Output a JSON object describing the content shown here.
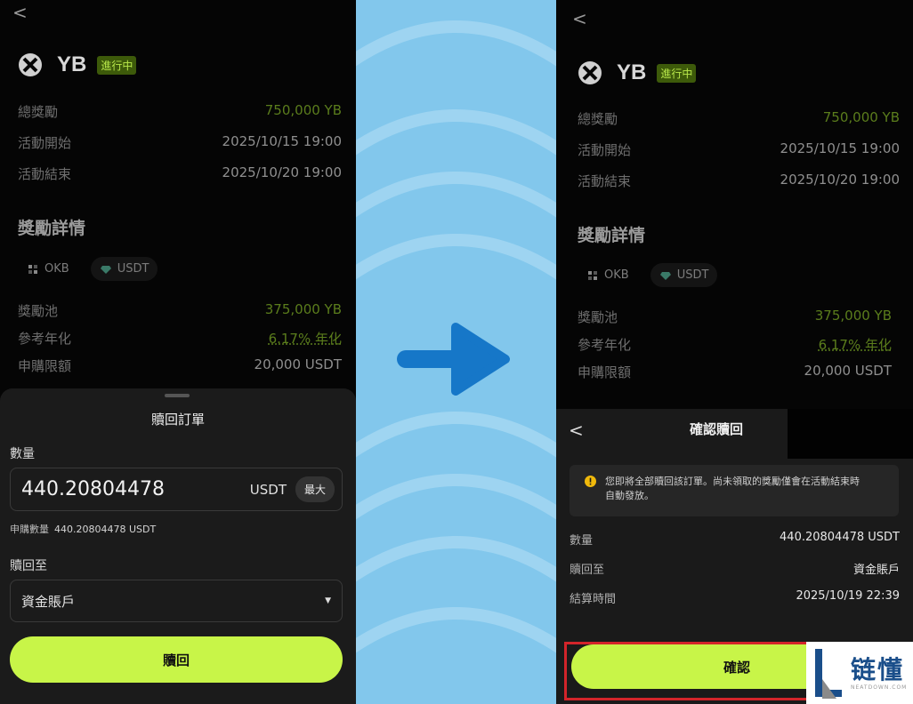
{
  "colors": {
    "accent": "#c8f548",
    "positive": "#5b7d1c",
    "badge_bg": "#3d5a0a",
    "badge_text": "#b8e84a",
    "highlight": "#d3242a",
    "arrow": "#1677c8"
  },
  "icons": {
    "back": "chevron-left-icon",
    "coin": "yb-coin-icon",
    "okb": "okb-icon",
    "usdt": "usdt-icon",
    "dropdown": "caret-down-icon",
    "warning": "warning-icon",
    "arrow": "arrow-right-icon"
  },
  "common": {
    "back_glyph": "<",
    "coin_name": "YB",
    "status_badge": "進行中",
    "total_reward_label": "總獎勵",
    "total_reward_value": "750,000 YB",
    "start_label": "活動開始",
    "start_value": "2025/10/15 19:00",
    "end_label": "活動結束",
    "end_value": "2025/10/20 19:00",
    "section_title": "獎勵詳情",
    "chip_okb": "OKB",
    "chip_usdt": "USDT",
    "pool_label": "獎勵池",
    "pool_value": "375,000 YB",
    "apr_label": "參考年化",
    "apr_value": "6.17% 年化",
    "limit_label": "申購限額",
    "limit_value": "20,000 USDT"
  },
  "redeem_sheet": {
    "title": "贖回訂單",
    "quantity_label": "數量",
    "amount_value": "440.20804478",
    "amount_unit": "USDT",
    "max_label": "最大",
    "subscribed_label": "申購數量",
    "subscribed_value": "440.20804478 USDT",
    "redeem_to_label": "贖回至",
    "redeem_to_value": "資金賬戶",
    "redeem_button": "贖回"
  },
  "confirm_dialog": {
    "back_glyph": "<",
    "title": "確認贖回",
    "notice_line1": "您即將全部贖回該訂單。尚未領取的獎勵僅會在活動結束時",
    "notice_line2": "自動發放。",
    "quantity_label": "數量",
    "quantity_value": "440.20804478 USDT",
    "redeem_to_label": "贖回至",
    "redeem_to_value": "資金賬戶",
    "settle_label": "結算時間",
    "settle_value": "2025/10/19 22:39",
    "confirm_button": "確認"
  },
  "watermark": {
    "brand_cn": "链懂",
    "brand_en": "NEATDOWN.COM"
  }
}
